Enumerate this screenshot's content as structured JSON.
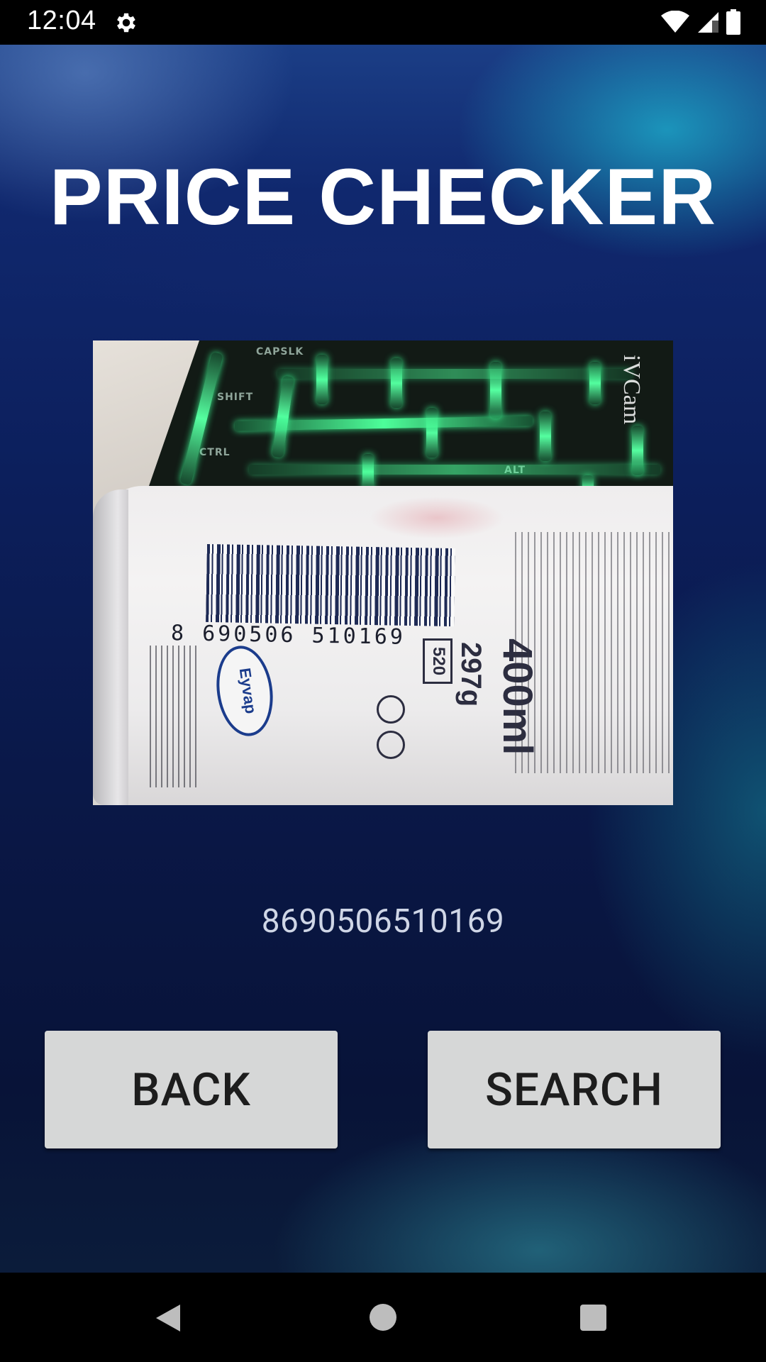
{
  "status_bar": {
    "time": "12:04",
    "icons": [
      "gear-icon",
      "wifi-icon",
      "signal-icon",
      "battery-icon"
    ]
  },
  "title": "PRICE CHECKER",
  "preview": {
    "watermark": "iVCam",
    "barcode_digits": "8 690506 510169",
    "volume": "400ml",
    "weight": "297g",
    "box_code": "520",
    "brand": "Eyvap"
  },
  "barcode_value": "8690506510169",
  "buttons": {
    "back": "BACK",
    "search": "SEARCH"
  },
  "nav_bar": {
    "icons": [
      "nav-back-icon",
      "nav-home-icon",
      "nav-recents-icon"
    ]
  },
  "colors": {
    "button_bg": "#d6d7d7",
    "title_text": "#ffffff",
    "barcode_text": "#cfd6e6",
    "background_top": "#1b3e86",
    "background_bottom": "#0b1c3a"
  }
}
